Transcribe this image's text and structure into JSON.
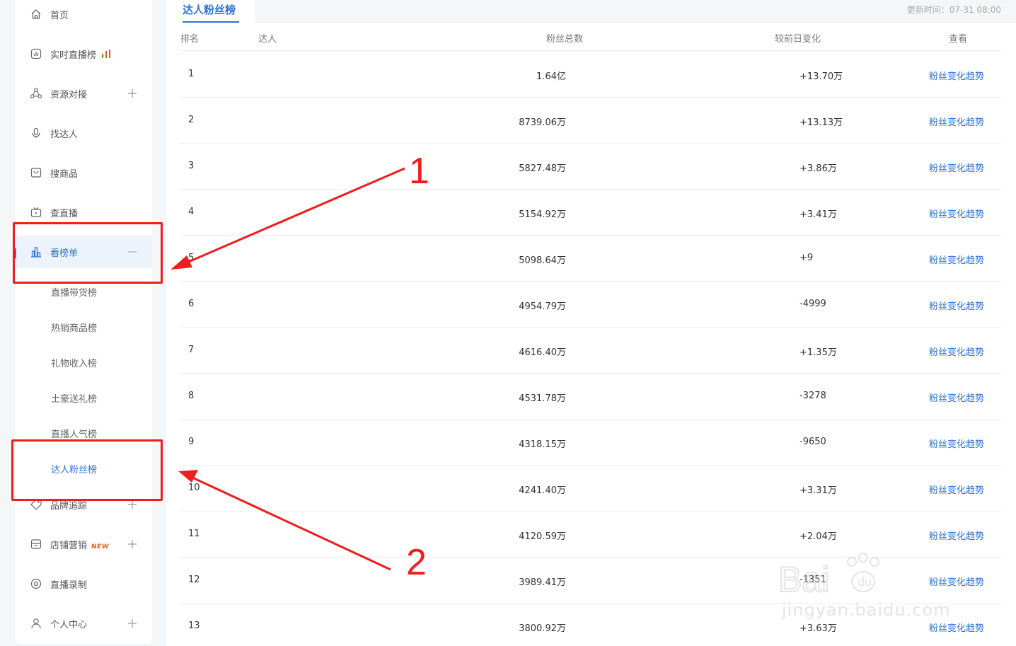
{
  "sidebar": {
    "items": [
      {
        "label": "首页",
        "icon": "home-icon"
      },
      {
        "label": "实时直播榜",
        "icon": "chart-square-icon"
      },
      {
        "label": "资源对接",
        "icon": "network-icon"
      },
      {
        "label": "找达人",
        "icon": "microphone-icon"
      },
      {
        "label": "搜商品",
        "icon": "bag-icon"
      },
      {
        "label": "查直播",
        "icon": "tv-icon"
      },
      {
        "label": "看榜单",
        "icon": "bar-chart-icon"
      },
      {
        "label": "品牌追踪",
        "icon": "tag-icon"
      },
      {
        "label": "店铺营销",
        "icon": "store-icon",
        "badge": "NEW"
      },
      {
        "label": "直播录制",
        "icon": "record-icon"
      },
      {
        "label": "个人中心",
        "icon": "user-icon"
      }
    ],
    "subitems": [
      "直播带货榜",
      "热销商品榜",
      "礼物收入榜",
      "土豪送礼榜",
      "直播人气榜",
      "达人粉丝榜"
    ]
  },
  "header": {
    "tab": "达人粉丝榜",
    "update_time": "更新时间：07-31 08:00"
  },
  "table": {
    "columns": [
      "排名",
      "达人",
      "粉丝总数",
      "较前日变化",
      "查看"
    ],
    "rows": [
      {
        "rank": "1",
        "fans": "1.64亿",
        "change": "+13.70万",
        "link": "粉丝变化趋势"
      },
      {
        "rank": "2",
        "fans": "8739.06万",
        "change": "+13.13万",
        "link": "粉丝变化趋势"
      },
      {
        "rank": "3",
        "fans": "5827.48万",
        "change": "+3.86万",
        "link": "粉丝变化趋势"
      },
      {
        "rank": "4",
        "fans": "5154.92万",
        "change": "+3.41万",
        "link": "粉丝变化趋势"
      },
      {
        "rank": "5",
        "fans": "5098.64万",
        "change": "+9",
        "link": "粉丝变化趋势"
      },
      {
        "rank": "6",
        "fans": "4954.79万",
        "change": "-4999",
        "link": "粉丝变化趋势"
      },
      {
        "rank": "7",
        "fans": "4616.40万",
        "change": "+1.35万",
        "link": "粉丝变化趋势"
      },
      {
        "rank": "8",
        "fans": "4531.78万",
        "change": "-3278",
        "link": "粉丝变化趋势"
      },
      {
        "rank": "9",
        "fans": "4318.15万",
        "change": "-9650",
        "link": "粉丝变化趋势"
      },
      {
        "rank": "10",
        "fans": "4241.40万",
        "change": "+3.31万",
        "link": "粉丝变化趋势"
      },
      {
        "rank": "11",
        "fans": "4120.59万",
        "change": "+2.04万",
        "link": "粉丝变化趋势"
      },
      {
        "rank": "12",
        "fans": "3989.41万",
        "change": "-1351",
        "link": "粉丝变化趋势"
      },
      {
        "rank": "13",
        "fans": "3800.92万",
        "change": "+3.63万",
        "link": "粉丝变化趋势"
      }
    ]
  },
  "annotations": {
    "first": "1",
    "second": "2"
  },
  "watermark": {
    "text": "jingyan.baidu.com",
    "logo": "Baidu 经验"
  },
  "colors": {
    "accent": "#2d72d9",
    "annotation": "#ef1d1d",
    "badge": "#e85d1a"
  }
}
